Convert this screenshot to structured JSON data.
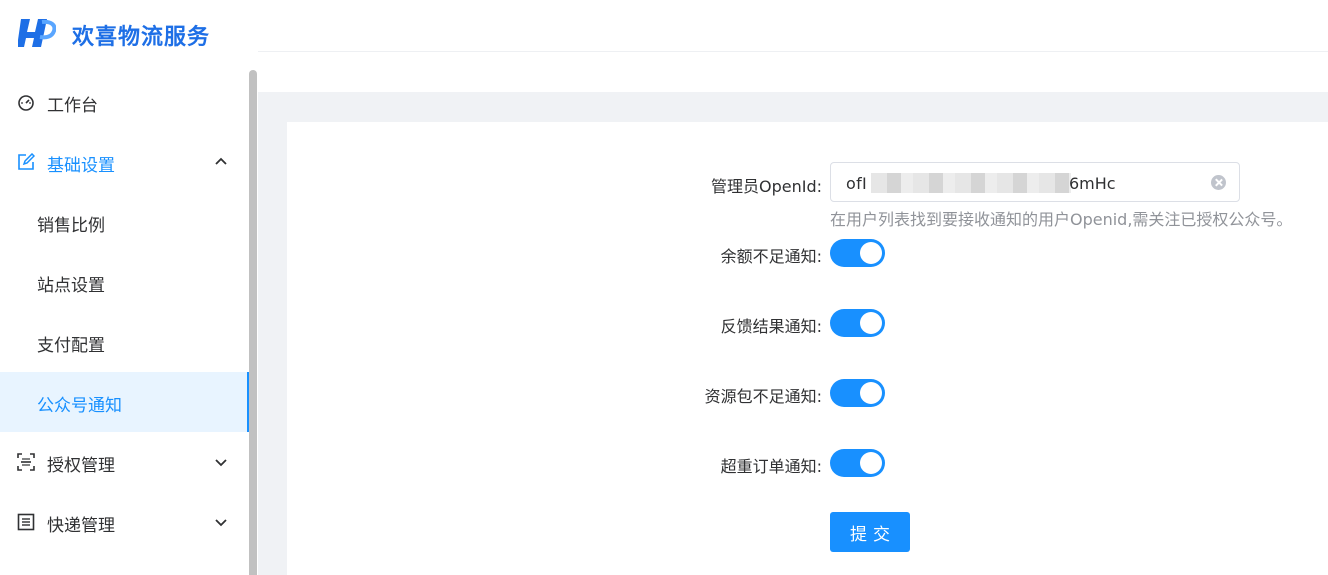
{
  "app": {
    "title": "欢喜物流服务",
    "brand_color": "#1e6fe6"
  },
  "sidebar": {
    "items": [
      {
        "label": "工作台",
        "icon": "dashboard-icon"
      },
      {
        "label": "基础设置",
        "icon": "edit-icon",
        "expanded": true,
        "children": [
          {
            "label": "销售比例"
          },
          {
            "label": "站点设置"
          },
          {
            "label": "支付配置"
          },
          {
            "label": "公众号通知",
            "active": true
          }
        ]
      },
      {
        "label": "授权管理",
        "icon": "scan-icon"
      },
      {
        "label": "快递管理",
        "icon": "list-icon"
      }
    ]
  },
  "form": {
    "openid": {
      "label": "管理员OpenId:",
      "value_prefix": "ofI",
      "value_suffix": "6mHc",
      "hint": "在用户列表找到要接收通知的用户Openid,需关注已授权公众号。"
    },
    "switches": [
      {
        "label": "余额不足通知:",
        "on": true
      },
      {
        "label": "反馈结果通知:",
        "on": true
      },
      {
        "label": "资源包不足通知:",
        "on": true
      },
      {
        "label": "超重订单通知:",
        "on": true
      }
    ],
    "submit_label": "提交"
  },
  "colors": {
    "accent": "#1890ff",
    "active_bg": "#e8f4ff"
  }
}
